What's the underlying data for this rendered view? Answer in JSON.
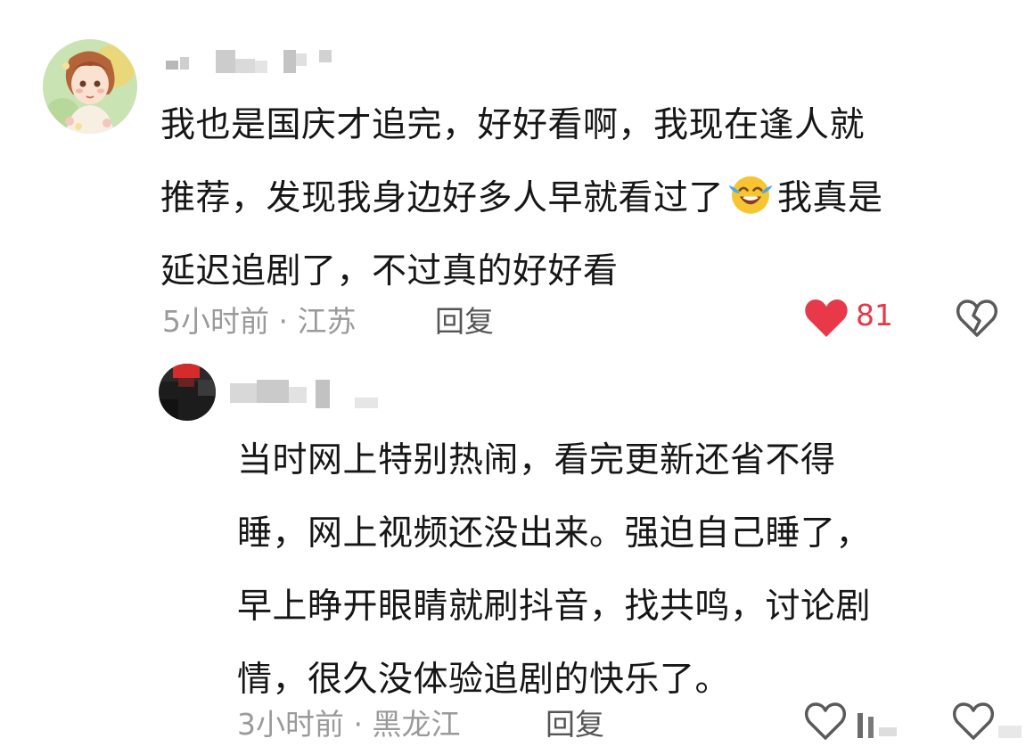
{
  "main_comment": {
    "lines": [
      "我也是国庆才追完，好好看啊，我现在逢人就",
      "推荐，发现我身边好多人早就看过了",
      "我真是",
      "延迟追剧了，不过真的好好看"
    ],
    "emoji": "laugh-cry-emoji",
    "meta": "5小时前 · 江苏",
    "reply_label": "回复",
    "likes": "81"
  },
  "reply_comment": {
    "lines": [
      "当时网上特别热闹，看完更新还省不得",
      "睡，网上视频还没出来。强迫自己睡了，",
      "早上睁开眼睛就刷抖音，找共鸣，讨论剧",
      "情，很久没体验追剧的快乐了。"
    ],
    "meta": "3小时前 · 黑龙江",
    "reply_label": "回复"
  },
  "colors": {
    "like_heart": "#e8394a",
    "meta_text": "#9a9a9a",
    "body_text": "#161616"
  }
}
